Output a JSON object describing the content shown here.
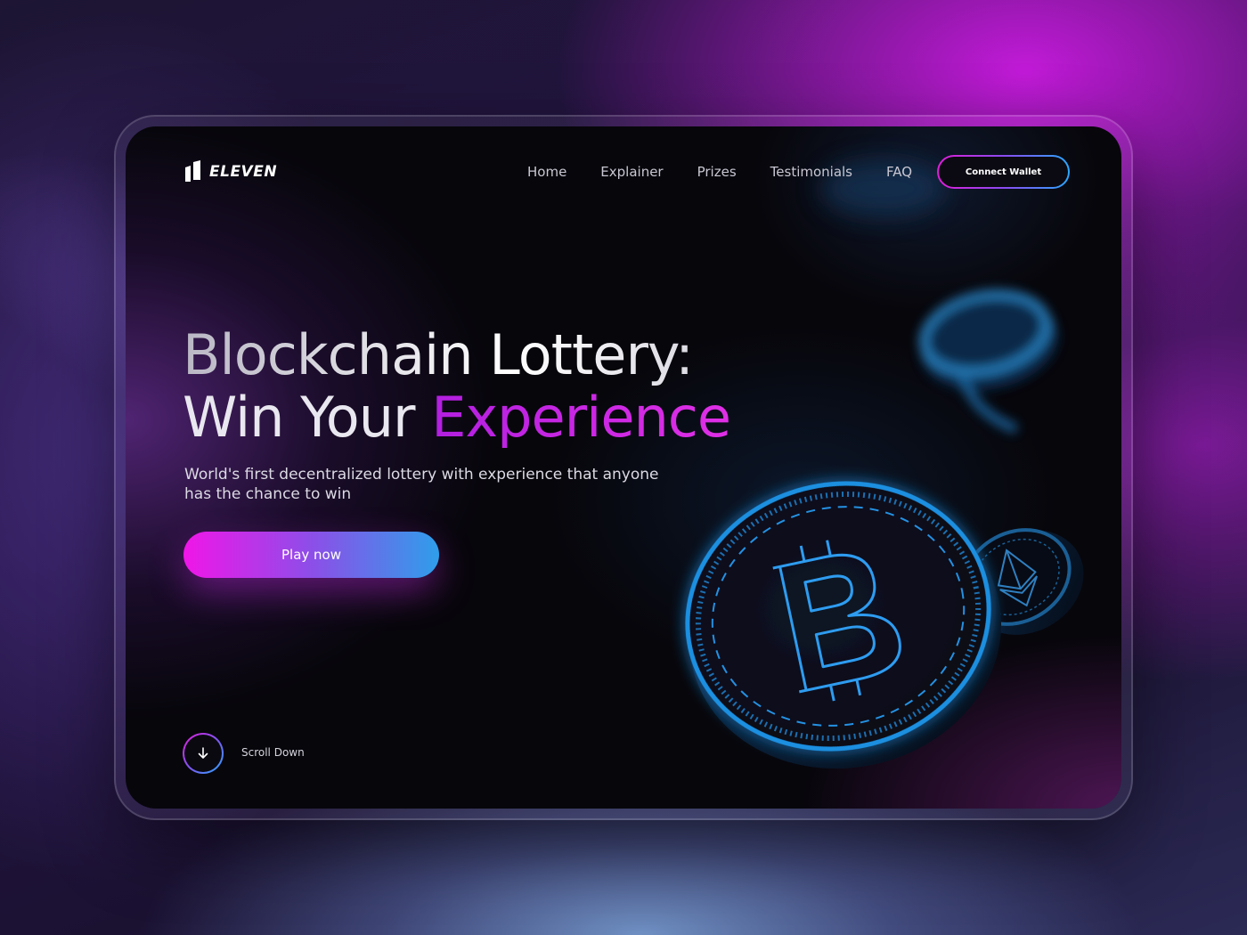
{
  "brand": {
    "name": "ELEVEN"
  },
  "nav": {
    "items": [
      {
        "label": "Home"
      },
      {
        "label": "Explainer"
      },
      {
        "label": "Prizes"
      },
      {
        "label": "Testimonials"
      },
      {
        "label": "FAQ"
      }
    ],
    "connect_label": "Connect Wallet"
  },
  "hero": {
    "title_line1": "Blockchain Lottery:",
    "title_line2_prefix": "Win Your ",
    "title_line2_accent": "Experience",
    "subtitle": "World's first decentralized lottery with experience that anyone has the chance to win",
    "cta_label": "Play now"
  },
  "scroll": {
    "label": "Scroll Down",
    "icon": "arrow-down-icon"
  },
  "illustration": {
    "coins": [
      "bitcoin-coin-icon",
      "ethereum-coin-icon",
      "blurred-coin-icon"
    ]
  },
  "colors": {
    "accent_magenta": "#e01dd8",
    "accent_purple": "#b21fe0",
    "accent_blue": "#2aa8ff",
    "coin_blue": "#1c8fe0",
    "screen_bg": "#07060b"
  }
}
